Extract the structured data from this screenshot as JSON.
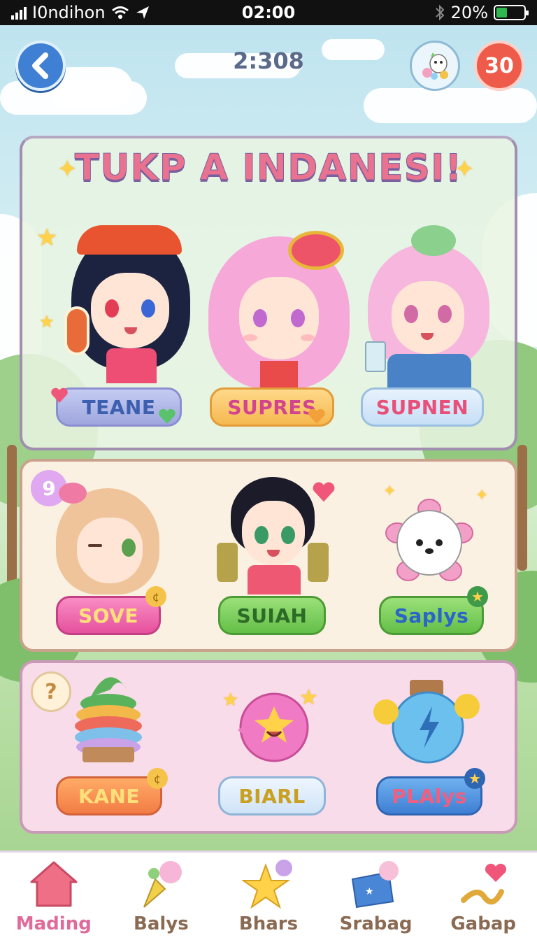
{
  "status_bar": {
    "carrier": "I0ndihon",
    "time": "02:00",
    "battery": "20%",
    "battery_level": 0.2
  },
  "header": {
    "back_icon": "chevron-left-icon",
    "center_value": "2:308",
    "mascot_icon": "mascot-icon",
    "count": "30"
  },
  "banner": {
    "title": "TUKP A INDANESI!"
  },
  "characters": [
    {
      "label": "TEANE"
    },
    {
      "label": "SUPRES"
    },
    {
      "label": "SUPNEN"
    }
  ],
  "middle_row": [
    {
      "label": "SOVE"
    },
    {
      "label": "SUIAH"
    },
    {
      "label": "Saplys"
    }
  ],
  "bottom_row": {
    "help_icon": "?",
    "items": [
      {
        "label": "KANE"
      },
      {
        "label": "BIARL"
      },
      {
        "label": "PLAlys"
      }
    ]
  },
  "nav": [
    {
      "label": "Mading",
      "icon": "home-icon",
      "active": true
    },
    {
      "label": "Balys",
      "icon": "balloon-icon",
      "active": false
    },
    {
      "label": "Bhars",
      "icon": "star-icon",
      "active": false
    },
    {
      "label": "Srabag",
      "icon": "box-icon",
      "active": false
    },
    {
      "label": "Gabap",
      "icon": "heart-icon",
      "active": false
    }
  ],
  "colors": {
    "accent_pink": "#e06a9a",
    "accent_blue": "#3f7fd4",
    "badge_red": "#ee5b4a"
  }
}
